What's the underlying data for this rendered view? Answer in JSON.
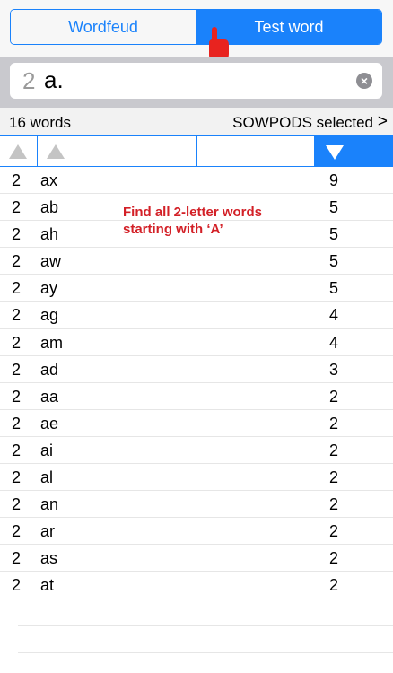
{
  "segments": {
    "wordfeud_label": "Wordfeud",
    "testword_label": "Test word"
  },
  "search": {
    "length": "2",
    "pattern": "a."
  },
  "summary": {
    "count": "16 words",
    "dictionary": "SOWPODS selected",
    "chevron": ">"
  },
  "annotation": "Find all 2-letter words\nstarting with ‘A’",
  "rows": [
    {
      "len": "2",
      "word": "ax",
      "score": "9"
    },
    {
      "len": "2",
      "word": "ab",
      "score": "5"
    },
    {
      "len": "2",
      "word": "ah",
      "score": "5"
    },
    {
      "len": "2",
      "word": "aw",
      "score": "5"
    },
    {
      "len": "2",
      "word": "ay",
      "score": "5"
    },
    {
      "len": "2",
      "word": "ag",
      "score": "4"
    },
    {
      "len": "2",
      "word": "am",
      "score": "4"
    },
    {
      "len": "2",
      "word": "ad",
      "score": "3"
    },
    {
      "len": "2",
      "word": "aa",
      "score": "2"
    },
    {
      "len": "2",
      "word": "ae",
      "score": "2"
    },
    {
      "len": "2",
      "word": "ai",
      "score": "2"
    },
    {
      "len": "2",
      "word": "al",
      "score": "2"
    },
    {
      "len": "2",
      "word": "an",
      "score": "2"
    },
    {
      "len": "2",
      "word": "ar",
      "score": "2"
    },
    {
      "len": "2",
      "word": "as",
      "score": "2"
    },
    {
      "len": "2",
      "word": "at",
      "score": "2"
    }
  ],
  "colors": {
    "accent": "#1a82fb",
    "annotation": "#d32027"
  },
  "icons": {
    "clear": "clear-circle-icon",
    "hand": "pointing-hand-icon",
    "sort_up": "sort-ascending-icon",
    "sort_down": "sort-descending-icon"
  }
}
